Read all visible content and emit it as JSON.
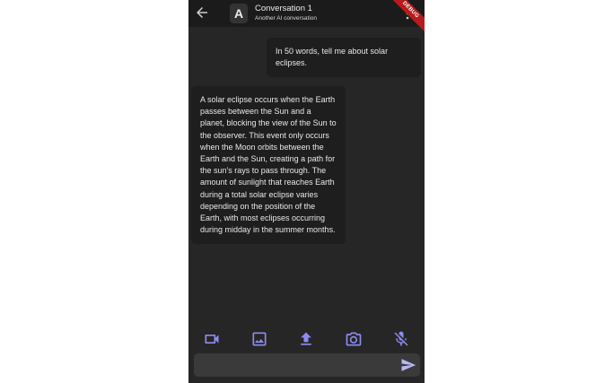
{
  "app_bar": {
    "avatar_letter": "A",
    "title": "Conversation 1",
    "subtitle": "Another AI conversation",
    "debug_banner": "DEBUG",
    "back_icon": "arrow-back-icon",
    "menu_icon": "more-vert-icon"
  },
  "messages": [
    {
      "role": "user",
      "text": "In 50 words, tell me about solar eclipses."
    },
    {
      "role": "assistant",
      "text": "A solar eclipse occurs when the Earth passes between the Sun and a planet, blocking the view of the Sun to the observer. This event only occurs when the Moon orbits between the Earth and the Sun, creating a path for the sun's rays to pass through. The amount of sunlight that reaches Earth during a total solar eclipse varies depending on the position of the Earth, with most eclipses occurring during midday in the summer months."
    }
  ],
  "toolbar": {
    "icons": [
      "videocam-icon",
      "image-icon",
      "upload-icon",
      "camera-icon",
      "mic-off-icon"
    ]
  },
  "composer": {
    "value": "",
    "placeholder": "",
    "send_icon": "send-icon",
    "send_color": "#b7b7f5"
  },
  "colors": {
    "background": "#262626",
    "app_bar": "#1b1b1b",
    "bubble": "#1e1e1e",
    "input": "#3a3a3a",
    "accent": "#8c8cf0",
    "debug": "#b71c1c"
  }
}
